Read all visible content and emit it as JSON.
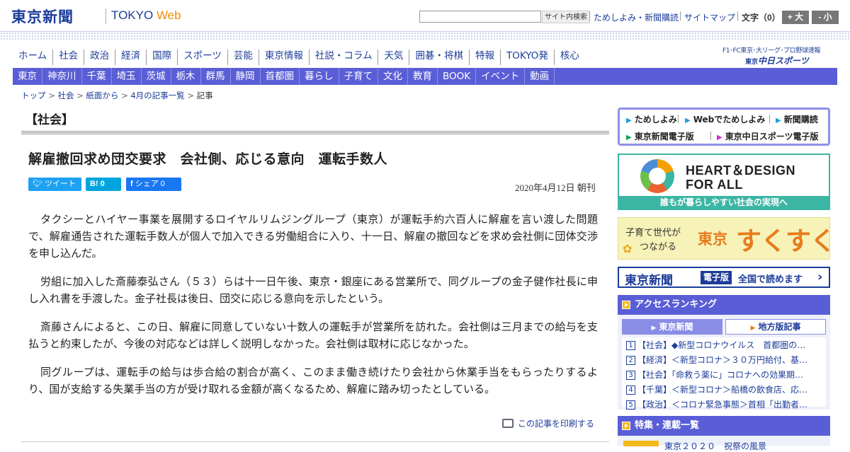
{
  "header": {
    "logo": "東京新聞",
    "logo_sub_a": "TOKYO",
    "logo_sub_b": "Web",
    "search_button": "サイト内検索",
    "links": [
      "ためしよみ・新聞購読",
      "サイトマップ"
    ],
    "font_size_label": "文字（0）",
    "font_plus": "+ 大",
    "font_minus": "- 小"
  },
  "nav_main": [
    "ホーム",
    "社会",
    "政治",
    "経済",
    "国際",
    "スポーツ",
    "芸能",
    "東京情報",
    "社説・コラム",
    "天気",
    "囲碁・将棋",
    "特報",
    "TOKYO発",
    "核心"
  ],
  "chunichi": {
    "topline": "F1･FC東京･大リーグ･プロ野球速報",
    "brand_small": "東京",
    "brand": "中日スポーツ"
  },
  "nav_local": [
    "東京",
    "神奈川",
    "千葉",
    "埼玉",
    "茨城",
    "栃木",
    "群馬",
    "静岡",
    "首都圏",
    "暮らし",
    "子育て",
    "文化",
    "教育",
    "BOOK",
    "イベント",
    "動画"
  ],
  "breadcrumb": {
    "items": [
      "トップ",
      "社会",
      "紙面から",
      "4月の記事一覧"
    ],
    "current": "記事",
    "sep": ">"
  },
  "article": {
    "section": "【社会】",
    "headline": "解雇撤回求め団交要求　会社側、応じる意向　運転手数人",
    "share": {
      "tweet": "ツイート",
      "hatena": "B! 0",
      "facebook": "シェア 0"
    },
    "date": "2020年4月12日 朝刊",
    "paragraphs": [
      "タクシーとハイヤー事業を展開するロイヤルリムジングループ（東京）が運転手約六百人に解雇を言い渡した問題で、解雇通告された運転手数人が個人で加入できる労働組合に入り、十一日、解雇の撤回などを求め会社側に団体交渉を申し込んだ。",
      "労組に加入した斎藤泰弘さん（５３）らは十一日午後、東京・銀座にある営業所で、同グループの金子健作社長に申し入れ書を手渡した。金子社長は後日、団交に応じる意向を示したという。",
      "斎藤さんによると、この日、解雇に同意していない十数人の運転手が営業所を訪れた。会社側は三月までの給与を支払うと約束したが、今後の対応などは詳しく説明しなかった。会社側は取材に応じなかった。",
      "同グループは、運転手の給与は歩合給の割合が高く、このまま働き続けたり会社から休業手当をもらったりするより、国が支給する失業手当の方が受け取れる金額が高くなるため、解雇に踏み切ったとしている。"
    ],
    "print_label": "この記事を印刷する"
  },
  "sidebar": {
    "quick_links": [
      "ためしよみ",
      "Webでためしよみ",
      "新聞購読",
      "東京新聞電子版",
      "東京中日スポーツ電子版"
    ],
    "heart_design": {
      "line1": "HEART＆DESIGN",
      "line2": "FOR ALL",
      "band": "誰もが暮らしやすい社会の実現へ"
    },
    "sukusuku": {
      "line1": "子育て世代が",
      "line2": "つながる",
      "brand_tokyo": "東京",
      "brand": "すくすく"
    },
    "denshi": {
      "logo": "東京新聞",
      "badge": "電子版",
      "text": "全国で読めます",
      "arrow": "›"
    },
    "ranking": {
      "title": "アクセスランキング",
      "tabs": [
        "東京新聞",
        "地方版記事"
      ],
      "items": [
        {
          "n": "1",
          "text": "【社会】◆新型コロナウイルス　首都圏の…"
        },
        {
          "n": "2",
          "text": "【経済】＜新型コロナ＞３０万円給付、基…"
        },
        {
          "n": "3",
          "text": "【社会】「命救う薬に」コロナへの効果期…"
        },
        {
          "n": "4",
          "text": "【千葉】＜新型コロナ＞船橋の飲食店、応…"
        },
        {
          "n": "5",
          "text": "【政治】＜コロナ緊急事態＞首相「出勤者…"
        }
      ]
    },
    "tokushu": {
      "title": "特集・連載一覧",
      "item": "東京２０２０　祝祭の風景"
    }
  },
  "colors": {
    "brand_blue": "#1c3c99",
    "nav_purple": "#5a5ed6",
    "accent_orange": "#f18e00"
  }
}
